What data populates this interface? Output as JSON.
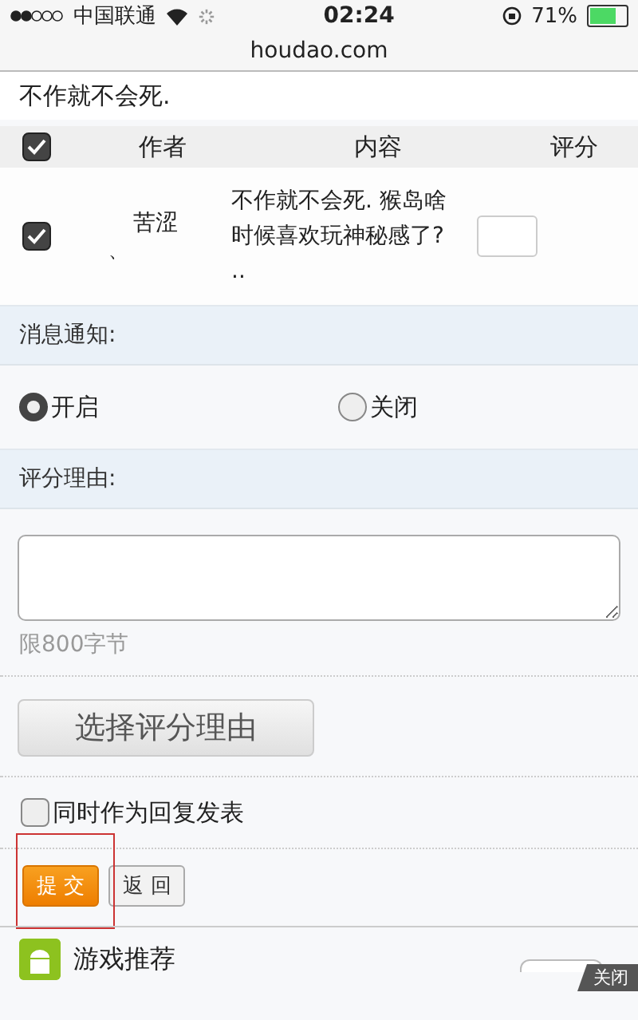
{
  "status_bar": {
    "carrier": "中国联通",
    "time": "02:24",
    "battery": "71%"
  },
  "address_bar": {
    "url": "houdao.com"
  },
  "intro_text": "不作就不会死.",
  "table": {
    "select_all_checked": true,
    "columns": [
      "作者",
      "内容",
      "评分"
    ],
    "rows": [
      {
        "checked": true,
        "author": "苦涩",
        "author_mark": "、",
        "content": "不作就不会死. 猴岛啥时候喜欢玩神秘感了? ..",
        "score": ""
      }
    ]
  },
  "notify": {
    "label": "消息通知:",
    "options": [
      {
        "label": "开启",
        "selected": true
      },
      {
        "label": "关闭",
        "selected": false
      }
    ]
  },
  "reason": {
    "label": "评分理由:",
    "hint": "限800字节",
    "choose_button": "选择评分理由"
  },
  "reply_option": {
    "label": "同时作为回复发表",
    "checked": false
  },
  "buttons": [
    {
      "label": "提 交",
      "kind": "primary"
    },
    {
      "label": "返 回",
      "kind": "secondary"
    }
  ],
  "bottom_bar": {
    "title": "游戏推荐",
    "close_label": "关闭"
  }
}
